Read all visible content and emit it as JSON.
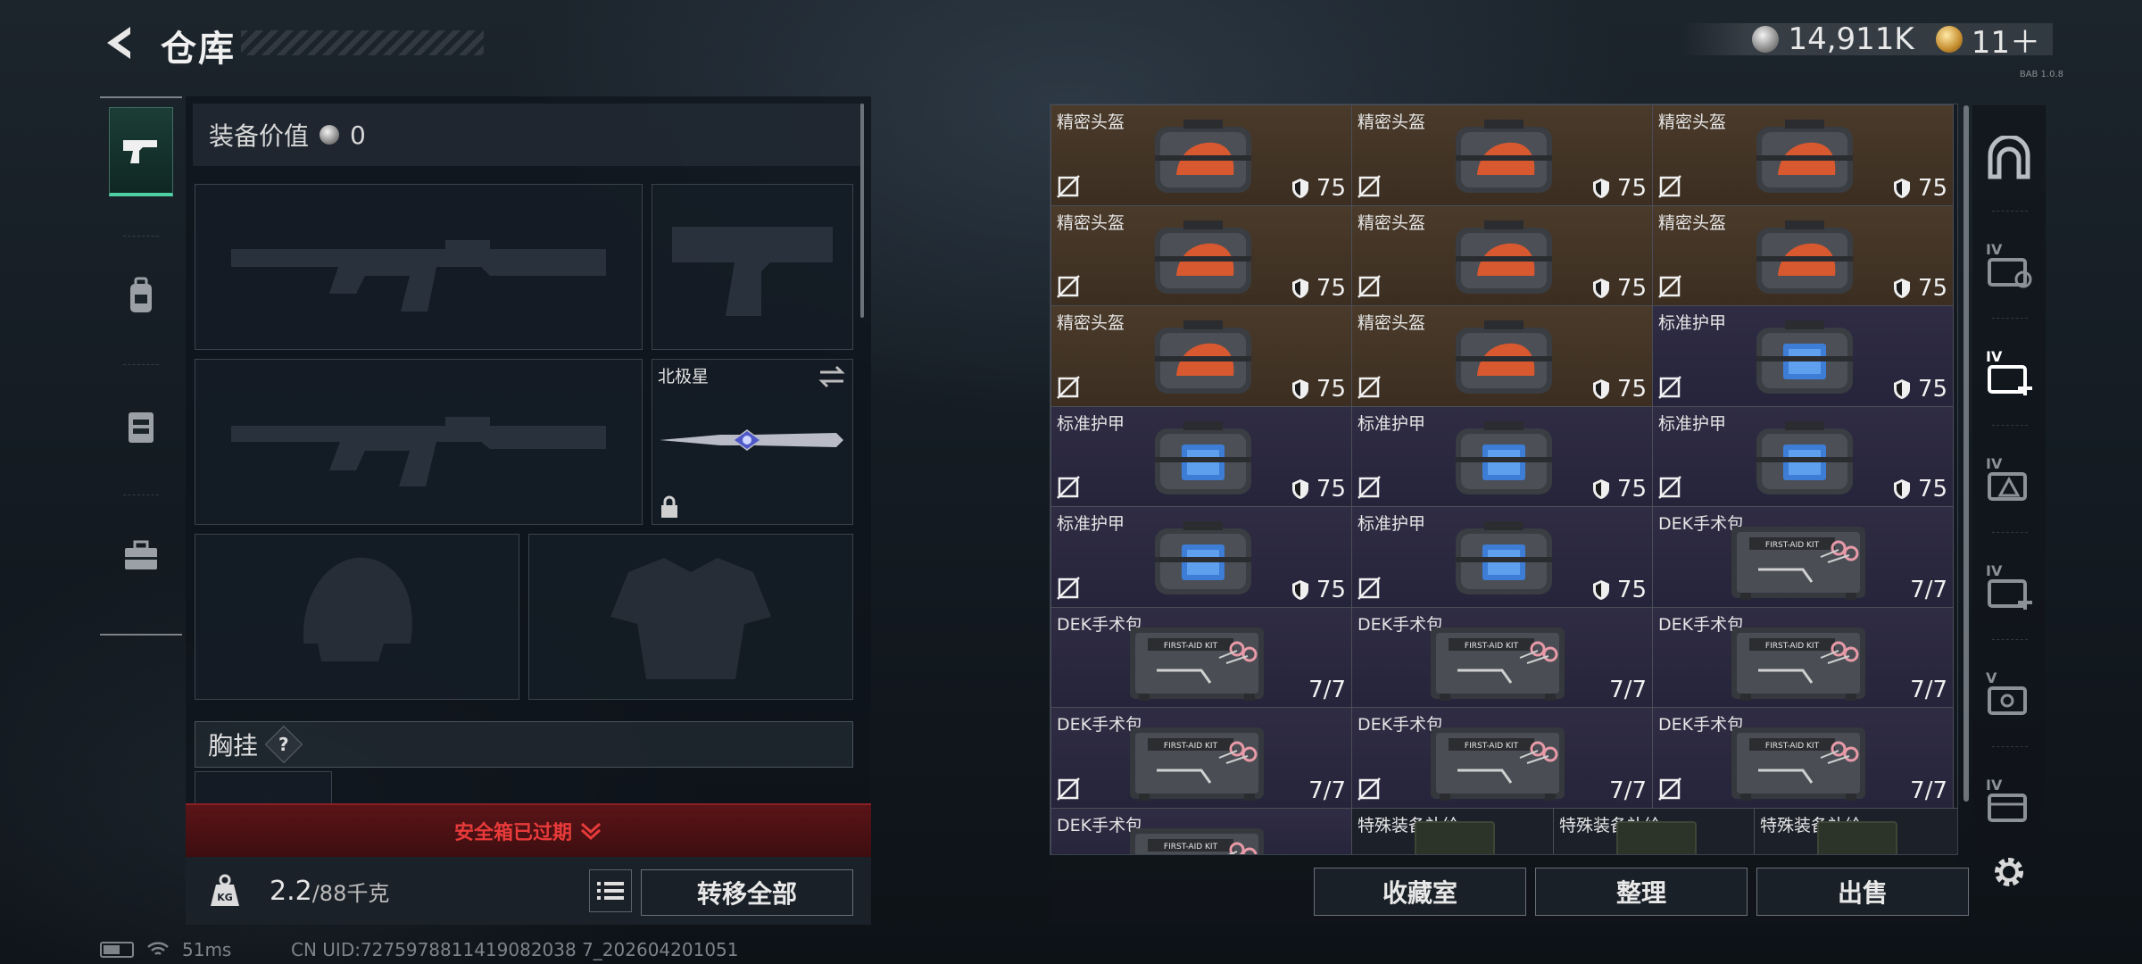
{
  "header": {
    "title": "仓库",
    "currency_silver": "14,911K",
    "currency_gold": "11＋",
    "version": "BAB 1.0.8"
  },
  "equipment": {
    "value_label": "装备价值",
    "value": "0",
    "melee_name": "北极星",
    "chest_label": "胸挂",
    "chest_help": "?",
    "safe_warning": "安全箱已过期",
    "weight_current": "2.2",
    "weight_max": "/88千克",
    "transfer_all": "转移全部"
  },
  "storage": {
    "items": [
      {
        "name": "精密头盔",
        "value": "75",
        "kind": "helmet"
      },
      {
        "name": "精密头盔",
        "value": "75",
        "kind": "helmet"
      },
      {
        "name": "精密头盔",
        "value": "75",
        "kind": "helmet"
      },
      {
        "name": "精密头盔",
        "value": "75",
        "kind": "helmet"
      },
      {
        "name": "精密头盔",
        "value": "75",
        "kind": "helmet"
      },
      {
        "name": "精密头盔",
        "value": "75",
        "kind": "helmet"
      },
      {
        "name": "精密头盔",
        "value": "75",
        "kind": "helmet"
      },
      {
        "name": "精密头盔",
        "value": "75",
        "kind": "helmet"
      },
      {
        "name": "标准护甲",
        "value": "75",
        "kind": "armor"
      },
      {
        "name": "标准护甲",
        "value": "75",
        "kind": "armor"
      },
      {
        "name": "标准护甲",
        "value": "75",
        "kind": "armor"
      },
      {
        "name": "标准护甲",
        "value": "75",
        "kind": "armor"
      },
      {
        "name": "标准护甲",
        "value": "75",
        "kind": "armor"
      },
      {
        "name": "标准护甲",
        "value": "75",
        "kind": "armor"
      },
      {
        "name": "DEK手术包",
        "value": "7/7",
        "kind": "kit"
      },
      {
        "name": "DEK手术包",
        "value": "7/7",
        "kind": "kit"
      },
      {
        "name": "DEK手术包",
        "value": "7/7",
        "kind": "kit"
      },
      {
        "name": "DEK手术包",
        "value": "7/7",
        "kind": "kit"
      },
      {
        "name": "DEK手术包",
        "value": "7/7",
        "kind": "kit"
      },
      {
        "name": "DEK手术包",
        "value": "7/7",
        "kind": "kit"
      },
      {
        "name": "DEK手术包",
        "value": "7/7",
        "kind": "kit"
      }
    ],
    "partial_row": [
      "DEK手术包",
      "特殊装备补给",
      "特殊装备补给",
      "特殊装备补给"
    ],
    "kit_print": "FIRST-AID KIT",
    "tier_labels": [
      "IV",
      "IV",
      "IV",
      "IV",
      "V",
      "IV"
    ],
    "btn_collection": "收藏室",
    "btn_sort": "整理",
    "btn_sell": "出售"
  },
  "status": {
    "ping": "51ms",
    "uid": "CN UID:7275978811419082038 7_202604201051"
  },
  "colors": {
    "accent_green": "#4fd0a4",
    "warning_red": "#e83a3a",
    "helmet_bg": "#4a3a2a",
    "armor_bg": "#2f2c44"
  }
}
